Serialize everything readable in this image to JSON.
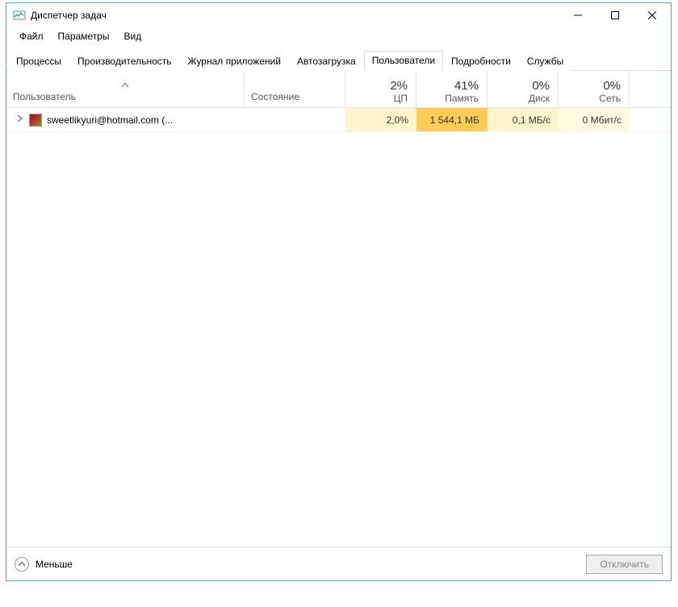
{
  "window": {
    "title": "Диспетчер задач"
  },
  "menu": {
    "file": "Файл",
    "options": "Параметры",
    "view": "Вид"
  },
  "tabs": {
    "processes": "Процессы",
    "performance": "Производительность",
    "app_history": "Журнал приложений",
    "startup": "Автозагрузка",
    "users": "Пользователи",
    "details": "Подробности",
    "services": "Службы",
    "active": "users"
  },
  "columns": {
    "user": "Пользователь",
    "status": "Состояние",
    "cpu": {
      "pct": "2%",
      "label": "ЦП"
    },
    "memory": {
      "pct": "41%",
      "label": "Память"
    },
    "disk": {
      "pct": "0%",
      "label": "Диск"
    },
    "network": {
      "pct": "0%",
      "label": "Сеть"
    }
  },
  "rows": [
    {
      "name": "sweetlikyuri@hotmail.com (...",
      "cpu": "2,0%",
      "memory": "1 544,1 МБ",
      "disk": "0,1 МБ/с",
      "network": "0 Мбит/с"
    }
  ],
  "footer": {
    "less": "Меньше",
    "disconnect": "Отключить"
  },
  "colors": {
    "heat_low": "#fff5cc",
    "heat_mid": "#ffcd57",
    "heat_vlow": "#fff9e0"
  }
}
